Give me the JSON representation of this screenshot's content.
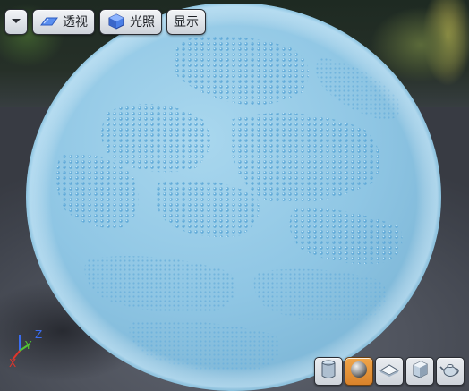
{
  "toolbar": {
    "perspective_label": "透视",
    "lighting_label": "光照",
    "show_label": "显示",
    "dropdown_icon": "chevron-down-icon",
    "perspective_icon": "perspective-view-icon",
    "lighting_icon": "lit-cube-icon"
  },
  "axes": {
    "x_label": "X",
    "y_label": "Y",
    "z_label": "Z",
    "x_color": "#e0352b",
    "y_color": "#52c234",
    "z_color": "#3a6cf0"
  },
  "preview_shapes": [
    {
      "name": "cylinder",
      "icon": "cylinder-icon",
      "active": false
    },
    {
      "name": "sphere",
      "icon": "sphere-icon",
      "active": true
    },
    {
      "name": "plane",
      "icon": "plane-icon",
      "active": false
    },
    {
      "name": "cube",
      "icon": "cube-icon",
      "active": false
    },
    {
      "name": "teapot",
      "icon": "teapot-icon",
      "active": false
    }
  ],
  "colors": {
    "material": "#8fc6e4",
    "active_shape": "#e08e35"
  }
}
